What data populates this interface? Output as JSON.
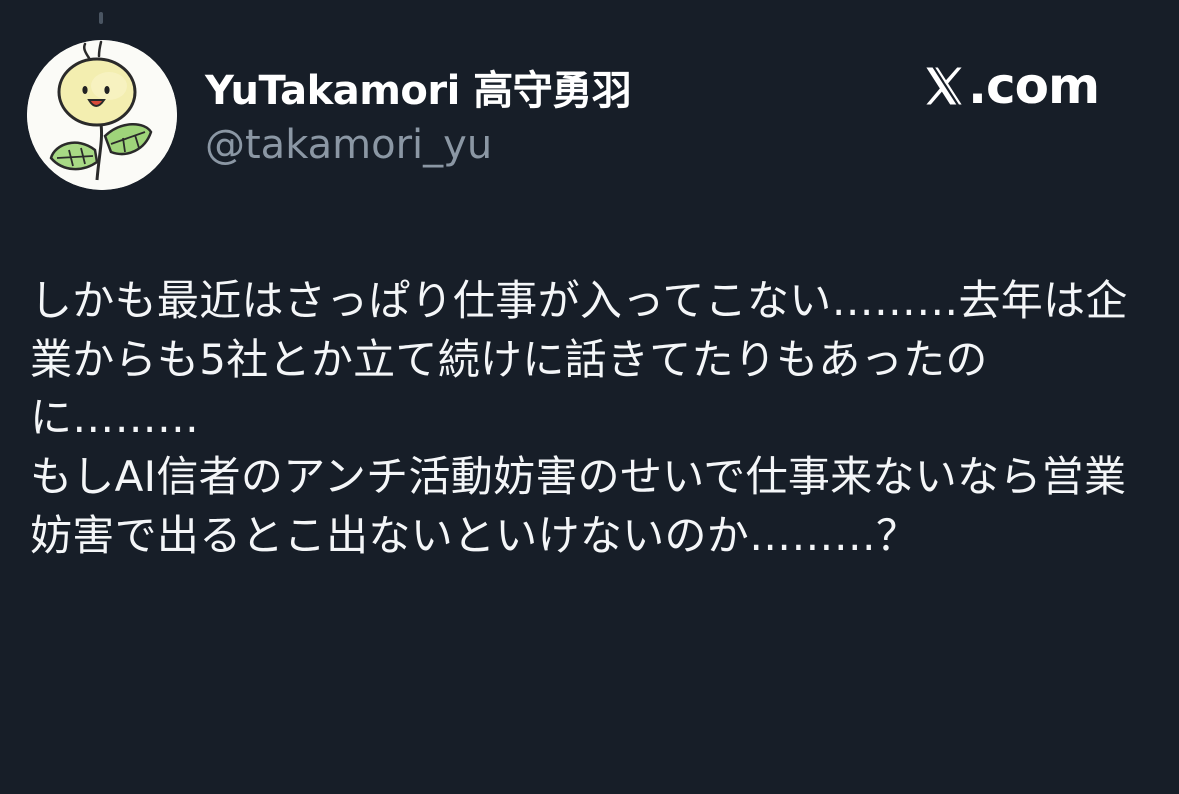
{
  "profile": {
    "display_name": "YuTakamori 高守勇羽",
    "handle": "@takamori_yu",
    "avatar_icon": "flower-sketch-avatar"
  },
  "brand": {
    "icon": "x-logo-icon",
    "text": ".com"
  },
  "tweet": {
    "text": "しかも最近はさっぱり仕事が入ってこない………去年は企業からも5社とか立て続けに話きてたりもあったのに………\nもしAI信者のアンチ活動妨害のせいで仕事来ないなら営業妨害で出るとこ出ないといけないのか………？"
  },
  "colors": {
    "background": "#171e28",
    "text": "#f4f6f8",
    "handle": "#8b97a4"
  }
}
